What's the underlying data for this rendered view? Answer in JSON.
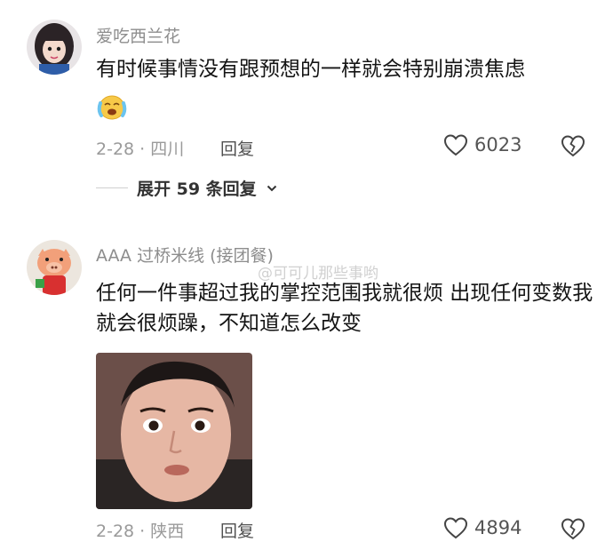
{
  "comments": [
    {
      "username": "爱吃西兰花",
      "text": "有时候事情没有跟预想的一样就会特别崩溃焦虑",
      "emoji": "crying-face-emoji",
      "meta": "2-28 · 四川",
      "reply_label": "回复",
      "likes": "6023",
      "expand_label": "展开 59 条回复"
    },
    {
      "username": "AAA 过桥米线 (接团餐)",
      "text": "任何一件事超过我的掌控范围我就很烦 出现任何变数我就会很烦躁，不知道怎么改变",
      "meta": "2-28 · 陕西",
      "reply_label": "回复",
      "likes": "4894"
    }
  ],
  "watermark": "@可可儿那些事哟",
  "colors": {
    "username": "#8d8d8d",
    "meta": "#9a9a9a",
    "text": "#141414"
  }
}
